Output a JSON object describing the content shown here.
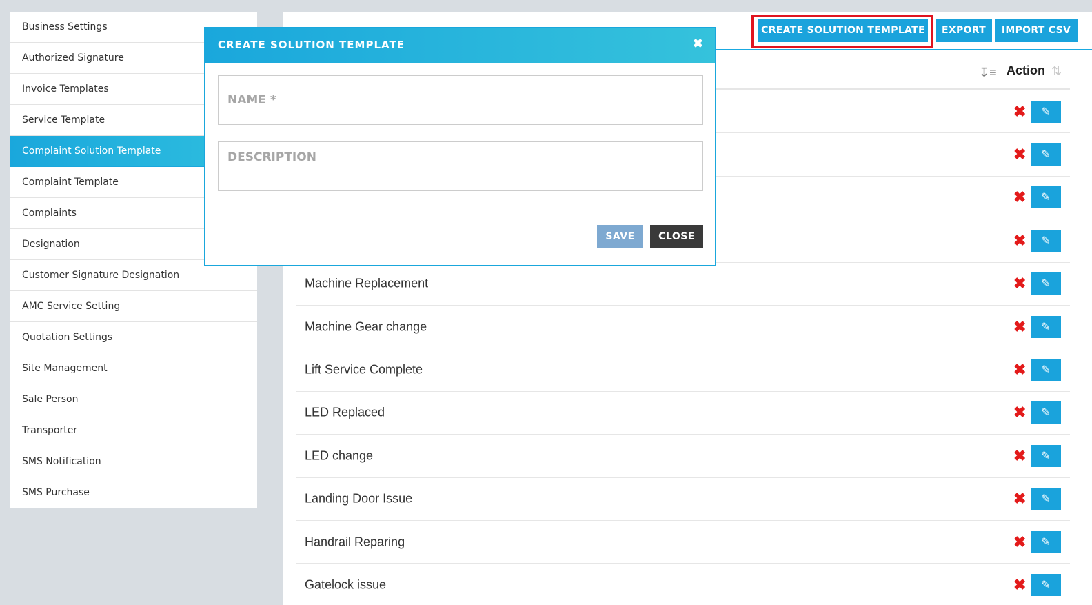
{
  "sidebar": {
    "items": [
      {
        "label": "Business Settings",
        "active": false
      },
      {
        "label": "Authorized Signature",
        "active": false
      },
      {
        "label": "Invoice Templates",
        "active": false
      },
      {
        "label": "Service Template",
        "active": false
      },
      {
        "label": "Complaint Solution Template",
        "active": true
      },
      {
        "label": "Complaint Template",
        "active": false
      },
      {
        "label": "Complaints",
        "active": false
      },
      {
        "label": "Designation",
        "active": false
      },
      {
        "label": "Customer Signature Designation",
        "active": false
      },
      {
        "label": "AMC Service Setting",
        "active": false
      },
      {
        "label": "Quotation Settings",
        "active": false
      },
      {
        "label": "Site Management",
        "active": false
      },
      {
        "label": "Sale Person",
        "active": false
      },
      {
        "label": "Transporter",
        "active": false
      },
      {
        "label": "SMS Notification",
        "active": false
      },
      {
        "label": "SMS Purchase",
        "active": false
      }
    ]
  },
  "toolbar": {
    "create_label": "CREATE SOLUTION TEMPLATE",
    "export_label": "EXPORT",
    "import_label": "IMPORT CSV"
  },
  "table": {
    "action_header": "Action",
    "rows": [
      {
        "name": ""
      },
      {
        "name": ""
      },
      {
        "name": ""
      },
      {
        "name": ""
      },
      {
        "name": "Machine Replacement"
      },
      {
        "name": "Machine Gear change"
      },
      {
        "name": "Lift Service Complete"
      },
      {
        "name": "LED Replaced"
      },
      {
        "name": "LED change"
      },
      {
        "name": "Landing Door Issue"
      },
      {
        "name": "Handrail Reparing"
      },
      {
        "name": "Gatelock issue"
      }
    ]
  },
  "modal": {
    "title": "CREATE SOLUTION TEMPLATE",
    "name_placeholder": "NAME *",
    "description_placeholder": "DESCRIPTION",
    "save_label": "SAVE",
    "close_label": "CLOSE"
  },
  "colors": {
    "accent": "#1aa3dc",
    "highlight": "#e0141f",
    "delete": "#e31a1a",
    "save_disabled": "#7ea9d1",
    "close_dark": "#3a3a3a"
  }
}
